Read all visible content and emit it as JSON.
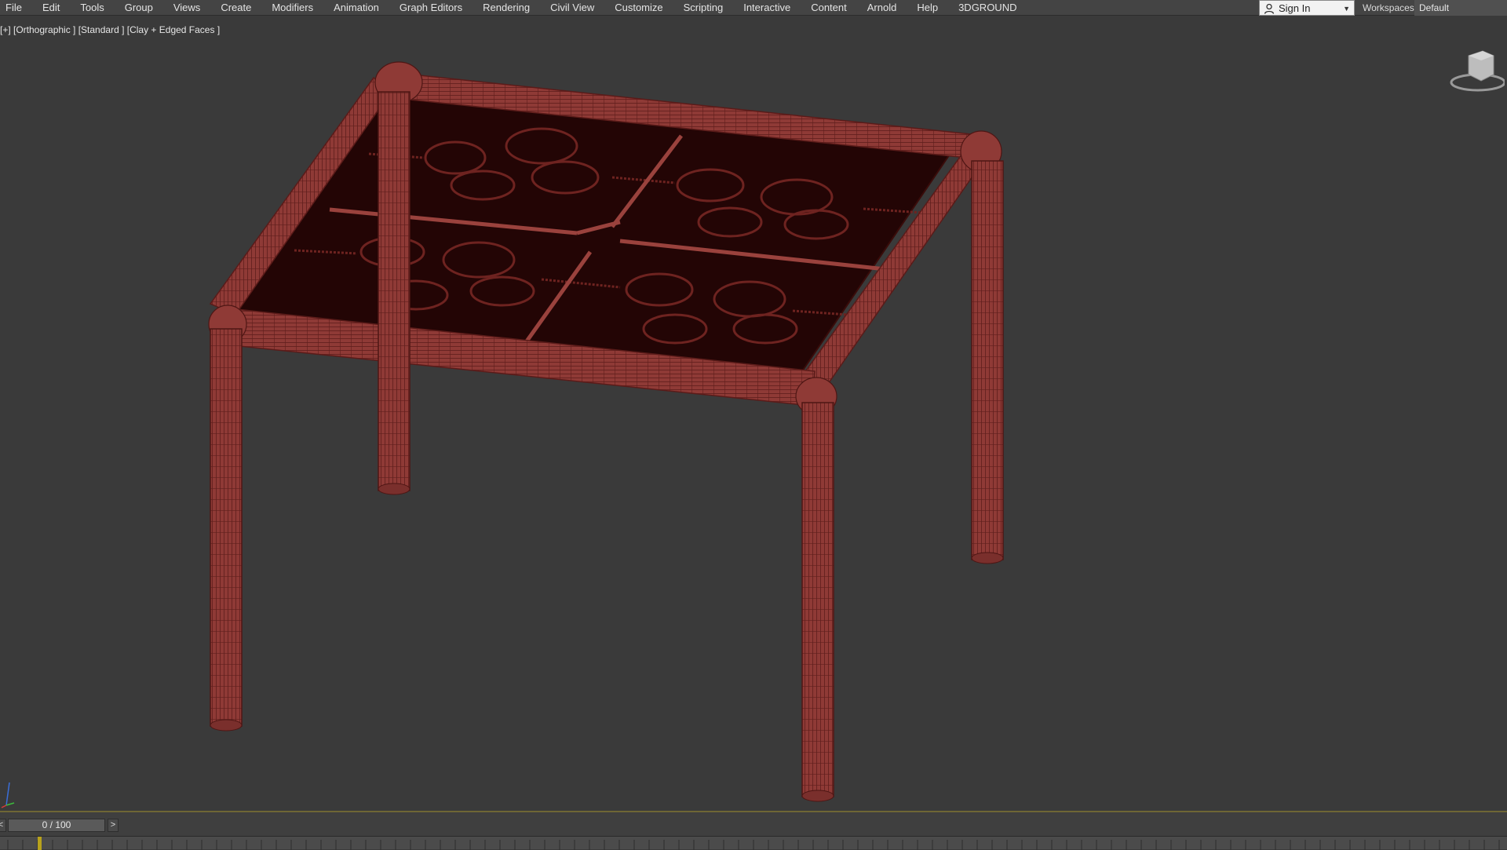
{
  "menubar": {
    "items": [
      "File",
      "Edit",
      "Tools",
      "Group",
      "Views",
      "Create",
      "Modifiers",
      "Animation",
      "Graph Editors",
      "Rendering",
      "Civil View",
      "Customize",
      "Scripting",
      "Interactive",
      "Content",
      "Arnold",
      "Help",
      "3DGROUND"
    ],
    "signin_label": "Sign In",
    "workspaces_label": "Workspaces:",
    "workspace_value": "Default"
  },
  "viewport": {
    "label": "[+] [Orthographic ] [Standard ] [Clay + Edged Faces ]",
    "model_color": "#8f3a36",
    "glass_color": "#230505",
    "background": "#3a3a3a"
  },
  "timebar": {
    "frame_display": "0 / 100",
    "prev_label": "<",
    "next_label": ">"
  },
  "icons": {
    "user": "user-icon",
    "viewcube": "viewcube-icon",
    "axis": "axis-gizmo-icon"
  }
}
